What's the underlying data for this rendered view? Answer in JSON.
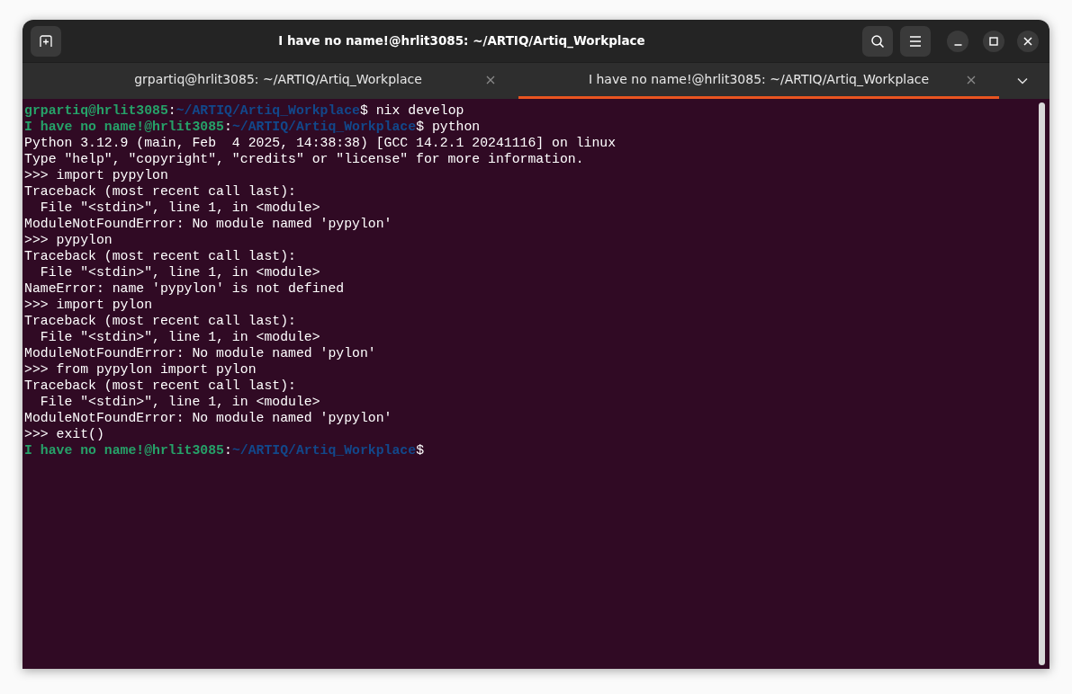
{
  "window": {
    "title": "I have no name!@hrlit3085: ~/ARTIQ/Artiq_Workplace"
  },
  "tabs": [
    {
      "label": "grpartiq@hrlit3085: ~/ARTIQ/Artiq_Workplace",
      "selected": false
    },
    {
      "label": "I have no name!@hrlit3085: ~/ARTIQ/Artiq_Workplace",
      "selected": true
    }
  ],
  "terminal": {
    "lines": [
      {
        "kind": "prompt",
        "user": "grpartiq@hrlit3085",
        "separator": ":",
        "path": "~/ARTIQ/Artiq_Workplace",
        "symbol": "$",
        "command": " nix develop"
      },
      {
        "kind": "prompt",
        "user": "I have no name!@hrlit3085",
        "separator": ":",
        "path": "~/ARTIQ/Artiq_Workplace",
        "symbol": "$",
        "command": " python"
      },
      {
        "kind": "output",
        "text": "Python 3.12.9 (main, Feb  4 2025, 14:38:38) [GCC 14.2.1 20241116] on linux"
      },
      {
        "kind": "output",
        "text": "Type \"help\", \"copyright\", \"credits\" or \"license\" for more information."
      },
      {
        "kind": "output",
        "text": ">>> import pypylon"
      },
      {
        "kind": "output",
        "text": "Traceback (most recent call last):"
      },
      {
        "kind": "output",
        "text": "  File \"<stdin>\", line 1, in <module>"
      },
      {
        "kind": "output",
        "text": "ModuleNotFoundError: No module named 'pypylon'"
      },
      {
        "kind": "output",
        "text": ">>> pypylon"
      },
      {
        "kind": "output",
        "text": "Traceback (most recent call last):"
      },
      {
        "kind": "output",
        "text": "  File \"<stdin>\", line 1, in <module>"
      },
      {
        "kind": "output",
        "text": "NameError: name 'pypylon' is not defined"
      },
      {
        "kind": "output",
        "text": ">>> import pylon"
      },
      {
        "kind": "output",
        "text": "Traceback (most recent call last):"
      },
      {
        "kind": "output",
        "text": "  File \"<stdin>\", line 1, in <module>"
      },
      {
        "kind": "output",
        "text": "ModuleNotFoundError: No module named 'pylon'"
      },
      {
        "kind": "output",
        "text": ">>> from pypylon import pylon"
      },
      {
        "kind": "output",
        "text": "Traceback (most recent call last):"
      },
      {
        "kind": "output",
        "text": "  File \"<stdin>\", line 1, in <module>"
      },
      {
        "kind": "output",
        "text": "ModuleNotFoundError: No module named 'pypylon'"
      },
      {
        "kind": "output",
        "text": ">>> exit()"
      },
      {
        "kind": "prompt",
        "user": "I have no name!@hrlit3085",
        "separator": ":",
        "path": "~/ARTIQ/Artiq_Workplace",
        "symbol": "$"
      }
    ]
  }
}
